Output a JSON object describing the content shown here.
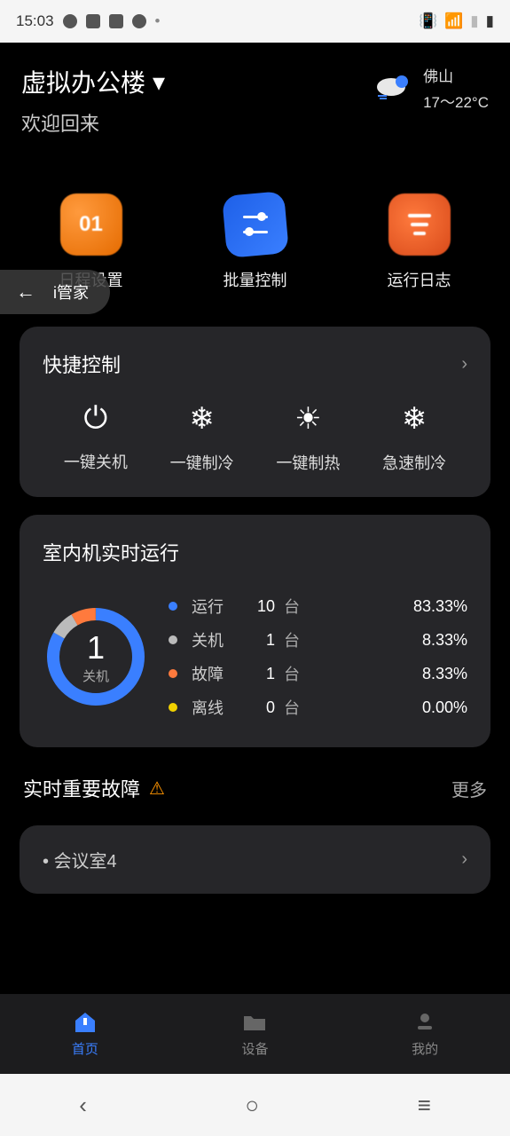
{
  "status_bar": {
    "time": "15:03"
  },
  "header": {
    "location": "虚拟办公楼",
    "welcome": "欢迎回来",
    "weather": {
      "city": "佛山",
      "temp": "17～22°C"
    }
  },
  "back_pill": {
    "label": "i管家"
  },
  "actions": [
    {
      "label": "日程设置",
      "date": "01"
    },
    {
      "label": "批量控制"
    },
    {
      "label": "运行日志"
    }
  ],
  "quick": {
    "title": "快捷控制",
    "items": [
      {
        "label": "一键关机",
        "icon": "⏻"
      },
      {
        "label": "一键制冷",
        "icon": "❄"
      },
      {
        "label": "一键制热",
        "icon": "☀"
      },
      {
        "label": "急速制冷",
        "icon": "❄"
      }
    ]
  },
  "runtime": {
    "title": "室内机实时运行",
    "center_num": "1",
    "center_label": "关机",
    "rows": [
      {
        "color": "#3a7fff",
        "name": "运行",
        "count": "10",
        "unit": "台",
        "pct": "83.33%"
      },
      {
        "color": "#bbbbbb",
        "name": "关机",
        "count": "1",
        "unit": "台",
        "pct": "8.33%"
      },
      {
        "color": "#ff7a3d",
        "name": "故障",
        "count": "1",
        "unit": "台",
        "pct": "8.33%"
      },
      {
        "color": "#f0d000",
        "name": "离线",
        "count": "0",
        "unit": "台",
        "pct": "0.00%"
      }
    ]
  },
  "faults": {
    "title": "实时重要故障",
    "more": "更多",
    "items": [
      {
        "name": "会议室4"
      }
    ]
  },
  "chart_data": {
    "type": "pie",
    "title": "室内机实时运行",
    "series": [
      {
        "name": "运行",
        "value": 10,
        "pct": 83.33,
        "color": "#3a7fff"
      },
      {
        "name": "关机",
        "value": 1,
        "pct": 8.33,
        "color": "#bbbbbb"
      },
      {
        "name": "故障",
        "value": 1,
        "pct": 8.33,
        "color": "#ff7a3d"
      },
      {
        "name": "离线",
        "value": 0,
        "pct": 0.0,
        "color": "#f0d000"
      }
    ]
  },
  "nav": {
    "items": [
      {
        "label": "首页"
      },
      {
        "label": "设备"
      },
      {
        "label": "我的"
      }
    ]
  }
}
